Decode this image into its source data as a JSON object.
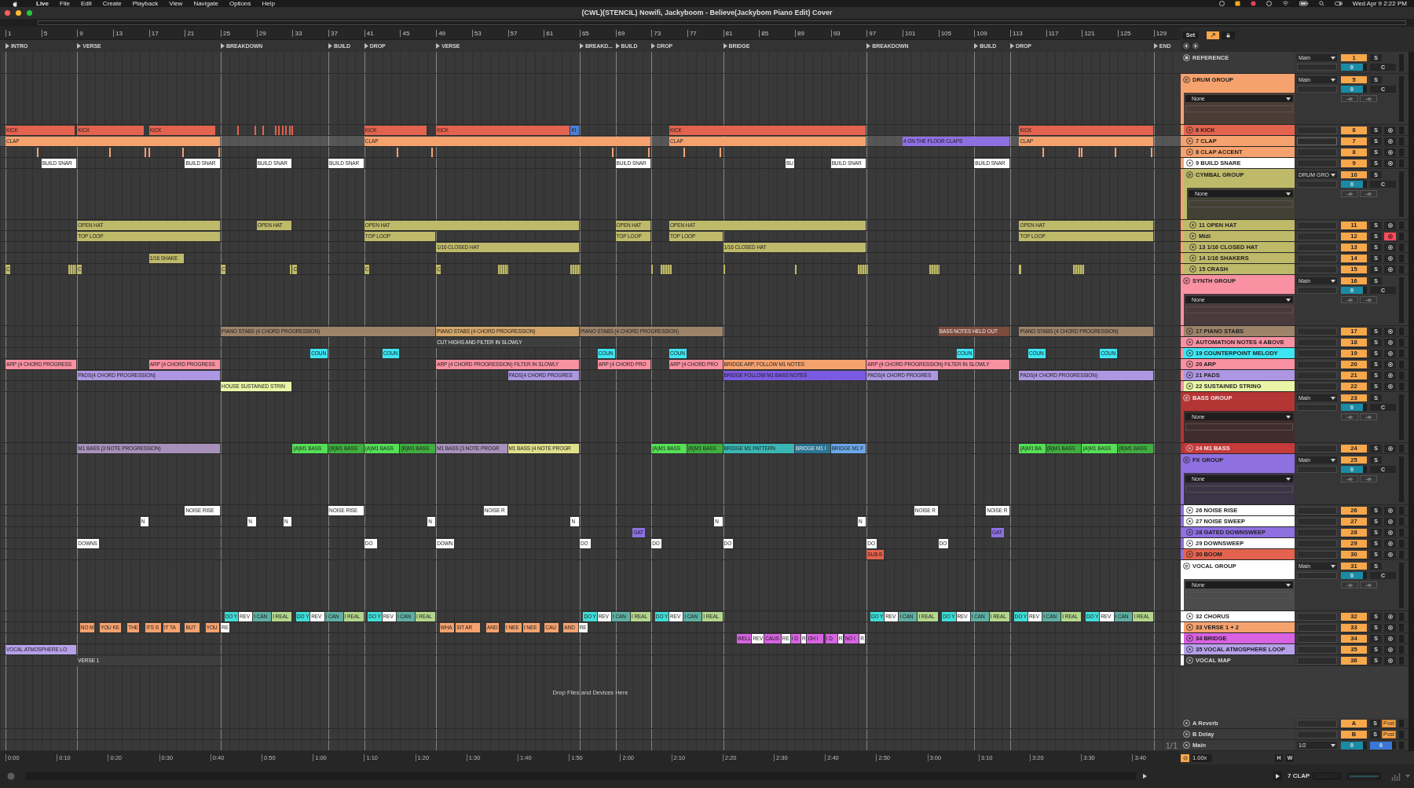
{
  "menu_bar": {
    "items": [
      "Live",
      "File",
      "Edit",
      "Create",
      "Playback",
      "View",
      "Navigate",
      "Options",
      "Help"
    ],
    "clock": "Wed Apr 9 2:22 PM"
  },
  "window": {
    "title": "(CWL)(STENCIL) Nowifi, Jackyboom - Believe(Jackybom Piano Edit) Cover"
  },
  "ruler": {
    "bars": [
      "1",
      "5",
      "9",
      "13",
      "17",
      "21",
      "25",
      "29",
      "33",
      "37",
      "41",
      "45",
      "49",
      "53",
      "57",
      "61",
      "65",
      "69",
      "73",
      "77",
      "81",
      "85",
      "89",
      "93",
      "97",
      "101",
      "105",
      "109",
      "113",
      "117",
      "121",
      "125",
      "129"
    ]
  },
  "locators": [
    "INTRO",
    "VERSE",
    "BREAKDOWN",
    "BUILD",
    "DROP",
    "VERSE",
    "BREAKD...",
    "BUILD",
    "DROP",
    "BRIDGE",
    "BREAKDOWN",
    "BUILD",
    "DROP"
  ],
  "end_marker": "END",
  "set_button": "Set",
  "tracks": [
    {
      "kind": "reference",
      "name": "REFERENCE",
      "selected": false,
      "routing": "Main",
      "number": "1",
      "solo": "S",
      "volume": "0",
      "cue": "C"
    },
    {
      "kind": "group",
      "name": "DRUM GROUP",
      "color": "#f6a26f",
      "selected": false,
      "device": "None",
      "routing": "Main",
      "number": "5",
      "solo": "S",
      "volume": "0",
      "cue": "C",
      "peaks": [
        "-∞",
        "-∞"
      ],
      "children": [
        {
          "kind": "track",
          "name": "6 KICK",
          "color": "#e3634f",
          "selected": false,
          "number": "6",
          "solo": "S",
          "armed": false,
          "clips": [
            {
              "kind": "clip",
              "name": "KICK"
            },
            {
              "kind": "clip",
              "name": "KICK"
            },
            {
              "kind": "clip",
              "name": "KICK"
            },
            {
              "kind": "hit"
            },
            {
              "kind": "hit"
            },
            {
              "kind": "hit"
            },
            {
              "kind": "hit"
            },
            {
              "kind": "hit"
            },
            {
              "kind": "hit"
            },
            {
              "kind": "hit"
            },
            {
              "kind": "hit"
            },
            {
              "kind": "hit"
            },
            {
              "kind": "clip",
              "name": "KICK"
            },
            {
              "kind": "clip",
              "name": "KICK"
            },
            {
              "kind": "clip",
              "name": "KI",
              "color": "#4b7fd6"
            },
            {
              "kind": "clip",
              "name": "KICK"
            },
            {
              "kind": "clip",
              "name": "KICK"
            }
          ]
        },
        {
          "kind": "track",
          "name": "7 CLAP",
          "color": "#f6a26f",
          "selected": true,
          "number": "7",
          "solo": "S",
          "armed": false,
          "clips": [
            {
              "name": "CLAP"
            },
            {
              "name": "CLAP"
            },
            {
              "name": "CLAP"
            },
            {
              "name": "4 ON THE FLOOR CLAPS",
              "color": "#8e70e1"
            },
            {
              "name": "CLAP"
            }
          ]
        },
        {
          "kind": "track",
          "name": "8 CLAP ACCENT",
          "color": "#f6a26f",
          "selected": false,
          "number": "8",
          "solo": "S",
          "armed": false,
          "clips": [
            {
              "kind": "hit"
            },
            {
              "kind": "hit"
            },
            {
              "kind": "hit"
            },
            {
              "kind": "hit"
            },
            {
              "kind": "hit"
            },
            {
              "kind": "hit"
            },
            {
              "kind": "hit"
            },
            {
              "kind": "hit"
            },
            {
              "kind": "hit"
            },
            {
              "kind": "hit"
            },
            {
              "kind": "hit"
            },
            {
              "kind": "hit"
            },
            {
              "kind": "hit"
            },
            {
              "kind": "hit"
            },
            {
              "kind": "hit"
            },
            {
              "kind": "hit"
            },
            {
              "kind": "hit"
            }
          ]
        },
        {
          "kind": "track",
          "name": "9 BUILD SNARE",
          "color": "#ffffff",
          "selected": false,
          "number": "9",
          "solo": "S",
          "armed": false,
          "clips": [
            {
              "name": "BUILD SNAR"
            },
            {
              "name": "BUILD SNAR"
            },
            {
              "name": "BUILD SNAR"
            },
            {
              "name": "BUILD SNAR"
            },
            {
              "name": "BUILD SNAR"
            },
            {
              "name": "BU"
            },
            {
              "name": "BUILD SNAR"
            },
            {
              "name": "BUILD SNAR"
            }
          ]
        },
        {
          "kind": "group",
          "name": "CYMBAL GROUP",
          "color": "#bfba6a",
          "selected": false,
          "device": "None",
          "routing": "DRUM GRO",
          "number": "10",
          "solo": "S",
          "volume": "0",
          "cue": "C",
          "peaks": [
            "-∞",
            "-∞"
          ],
          "children": [
            {
              "kind": "track",
              "name": "11 OPEN HAT",
              "color": "#bfba6a",
              "selected": false,
              "number": "11",
              "solo": "S",
              "armed": false,
              "clips": [
                {
                  "name": "OPEN HAT"
                },
                {
                  "name": "OPEN HAT"
                },
                {
                  "name": "OPEN HAT"
                },
                {
                  "name": "OPEN HAT"
                },
                {
                  "name": "OPEN HAT"
                },
                {
                  "name": "OPEN HAT"
                }
              ]
            },
            {
              "kind": "track",
              "name": "Midi",
              "color": "#bfba6a",
              "selected": false,
              "number": "12",
              "solo": "S",
              "armed": true,
              "clips": [
                {
                  "name": "TOP LOOP"
                },
                {
                  "name": "TOP LOOP"
                },
                {
                  "name": "TOP LOOP"
                },
                {
                  "name": "TOP LOOP"
                },
                {
                  "name": "TOP LOOP"
                }
              ]
            },
            {
              "kind": "track",
              "name": "13 1/16 CLOSED HAT",
              "color": "#bfba6a",
              "selected": false,
              "number": "13",
              "solo": "S",
              "armed": false,
              "clips": [
                {
                  "name": "1/16 CLOSED HAT"
                },
                {
                  "name": "1/16 CLOSED HAT"
                }
              ]
            },
            {
              "kind": "track",
              "name": "14 1/16 SHAKERS",
              "color": "#bfba6a",
              "selected": false,
              "number": "14",
              "solo": "S",
              "armed": false,
              "clips": [
                {
                  "name": "1/16 SHAKE"
                }
              ]
            },
            {
              "kind": "track",
              "name": "15 CRASH",
              "color": "#bfba6a",
              "selected": false,
              "number": "15",
              "solo": "S",
              "armed": false,
              "clips": [
                {
                  "kind": "clip",
                  "name": "C"
                },
                {
                  "kind": "hit"
                },
                {
                  "kind": "clip",
                  "name": "C"
                },
                {
                  "kind": "clip",
                  "name": "C"
                },
                {
                  "kind": "hit"
                },
                {
                  "kind": "clip",
                  "name": "C"
                },
                {
                  "kind": "clip",
                  "name": "C"
                },
                {
                  "kind": "clip",
                  "name": "C"
                },
                {
                  "kind": "hit"
                },
                {
                  "kind": "hit"
                },
                {
                  "kind": "hit"
                },
                {
                  "kind": "hit"
                },
                {
                  "kind": "hit"
                },
                {
                  "kind": "hit"
                },
                {
                  "kind": "hit"
                },
                {
                  "kind": "hit"
                },
                {
                  "kind": "hit"
                },
                {
                  "kind": "hit"
                }
              ]
            }
          ]
        }
      ]
    },
    {
      "kind": "group",
      "name": "SYNTH GROUP",
      "color": "#f991a2",
      "selected": false,
      "device": "None",
      "routing": "Main",
      "number": "16",
      "solo": "S",
      "volume": "0",
      "cue": "C",
      "peaks": [
        "-∞",
        "-∞"
      ],
      "children": [
        {
          "kind": "track",
          "name": "17 PIANO STABS",
          "color": "#9c8369",
          "selected": false,
          "number": "17",
          "solo": "S",
          "armed": false,
          "clips": [
            {
              "name": "PIANO STABS (4 CHORD PROGRESSION)"
            },
            {
              "name": "PIANO STABS (4 CHORD PROGRESSION)",
              "color": "#d4a66b"
            },
            {
              "name": "PIANO STABS (4 CHORD PROGRESSION)"
            },
            {
              "name": "BASS NOTES HELD OUT",
              "color": "#7d4c3d"
            },
            {
              "name": "PIANO STABS (4 CHORD PROGRESSION)"
            }
          ]
        },
        {
          "kind": "track",
          "name": "AUTOMATION NOTES 4 ABOVE",
          "color": "#f991a2",
          "selected": false,
          "number": "18",
          "solo": "S",
          "armed": false,
          "clips": [
            {
              "name": "CUT HIGHS AND FILTER IN SLOWLY",
              "color": "#3e3e3e"
            }
          ]
        },
        {
          "kind": "track",
          "name": "19 COUNTERPOINT MELODY",
          "color": "#3ee5f3",
          "selected": false,
          "number": "19",
          "solo": "S",
          "armed": false,
          "clips": [
            {
              "name": "COUN"
            },
            {
              "name": "COUN"
            },
            {
              "name": "COUN"
            },
            {
              "name": "COUN"
            },
            {
              "name": "COUN"
            },
            {
              "name": "COUN"
            },
            {
              "name": "COUN"
            }
          ]
        },
        {
          "kind": "track",
          "name": "20 ARP",
          "color": "#f991a2",
          "selected": false,
          "number": "20",
          "solo": "S",
          "armed": false,
          "clips": [
            {
              "name": "ARP (4 CHORD PROGRESS"
            },
            {
              "name": "ARP (4 CHORD PROGRESS"
            },
            {
              "name": "ARP (4 CHORD PROGRESSION) FILTER IN SLOWLY"
            },
            {
              "name": "ARP (4 CHORD PRO"
            },
            {
              "name": "ARP (4 CHORD PRO"
            },
            {
              "name": "BRIDGE ARP, FOLLOW M1 NOTES",
              "color": "#f6a26f"
            },
            {
              "name": "ARP (4 CHORD PROGRESSION) FILTER IN SLOWLY"
            }
          ]
        },
        {
          "kind": "track",
          "name": "21 PADS",
          "color": "#ad97e2",
          "selected": false,
          "number": "21",
          "solo": "S",
          "armed": false,
          "clips": [
            {
              "name": "PADS(4 CHORD PROGRESSION)"
            },
            {
              "name": "PADS(4 CHORD PROGRES"
            },
            {
              "name": "BRIDGE FOLLOW M1 BASS NOTES",
              "color": "#7b5be1"
            },
            {
              "name": "PADS(4 CHORD PROGRES"
            },
            {
              "name": "PADS(4 CHORD PROGRESSION)"
            }
          ]
        },
        {
          "kind": "track",
          "name": "22 SUSTAINED STRING",
          "color": "#eaf6a6",
          "selected": false,
          "number": "22",
          "solo": "S",
          "armed": false,
          "clips": [
            {
              "name": "HOUSE SUSTAINED STRIN"
            }
          ]
        }
      ]
    },
    {
      "kind": "group",
      "name": "BASS GROUP",
      "color": "#b53434",
      "selected": false,
      "device": "None",
      "routing": "Main",
      "number": "23",
      "solo": "S",
      "volume": "0",
      "cue": "C",
      "peaks": [
        "-∞",
        "-∞"
      ],
      "children": [
        {
          "kind": "track",
          "name": "24 M1 BASS",
          "color": "#c63a3a",
          "selected": false,
          "number": "24",
          "solo": "S",
          "armed": false,
          "clips": [
            {
              "name": "M1 BASS (3 NOTE PROGRESSION)",
              "color": "#a791ba"
            },
            {
              "name": "(A)M1 BASS",
              "color": "#55e055"
            },
            {
              "name": "(B)M1 BASS",
              "color": "#3fae3f"
            },
            {
              "name": "(A)M1 BASS",
              "color": "#55e055"
            },
            {
              "name": "(B)M1 BASS",
              "color": "#3fae3f"
            },
            {
              "name": "M1 BASS (3 NOTE PROGR",
              "color": "#a791ba"
            },
            {
              "name": "M1 BASS (4 NOTE PROGR",
              "color": "#e0e08c"
            },
            {
              "name": "(A)M1 BASS",
              "color": "#55e055"
            },
            {
              "name": "(B)M1 BASS",
              "color": "#3fae3f"
            },
            {
              "name": "BRIDGE M1 PATTERN",
              "color": "#3ab7b4"
            },
            {
              "name": "BRIDGE M1 I",
              "color": "#2b7594"
            },
            {
              "name": "BRIDGE M1 F",
              "color": "#6ba7e8"
            },
            {
              "name": "(A)M1 BA",
              "color": "#55e055"
            },
            {
              "name": "(B)M1 BASS",
              "color": "#3fae3f"
            },
            {
              "name": "(A)M1 BASS",
              "color": "#55e055"
            },
            {
              "name": "(B)M1 BASS",
              "color": "#3fae3f"
            }
          ]
        }
      ]
    },
    {
      "kind": "group",
      "name": "FX GROUP",
      "color": "#8e70e1",
      "selected": false,
      "device": "None",
      "routing": "Main",
      "number": "25",
      "solo": "S",
      "volume": "0",
      "cue": "C",
      "peaks": [
        "-∞",
        "-∞"
      ],
      "children": [
        {
          "kind": "track",
          "name": "26 NOISE RISE",
          "color": "#ffffff",
          "selected": false,
          "number": "26",
          "solo": "S",
          "armed": false,
          "clips": [
            {
              "name": "NOISE RISE"
            },
            {
              "name": "NOISE RISE"
            },
            {
              "name": "NOISE R"
            },
            {
              "name": "NOISE R"
            },
            {
              "name": "NOISE R"
            }
          ]
        },
        {
          "kind": "track",
          "name": "27 NOISE SWEEP",
          "color": "#ffffff",
          "selected": false,
          "number": "27",
          "solo": "S",
          "armed": false,
          "clips": [
            {
              "name": "N"
            },
            {
              "name": "N"
            },
            {
              "name": "N"
            },
            {
              "name": "N"
            },
            {
              "name": "N"
            },
            {
              "name": "N"
            },
            {
              "name": "N"
            }
          ]
        },
        {
          "kind": "track",
          "name": "28 GATED DOWNSWEEP",
          "color": "#8e70e1",
          "selected": false,
          "number": "28",
          "solo": "S",
          "armed": false,
          "clips": [
            {
              "name": "GAT"
            },
            {
              "name": "GAT"
            }
          ]
        },
        {
          "kind": "track",
          "name": "29 DOWNSWEEP",
          "color": "#ffffff",
          "selected": false,
          "number": "29",
          "solo": "S",
          "armed": false,
          "clips": [
            {
              "name": "DOWNS"
            },
            {
              "name": "DO"
            },
            {
              "name": "DOWN"
            },
            {
              "name": "DO"
            },
            {
              "name": "DO"
            },
            {
              "name": "DO"
            },
            {
              "name": "DO"
            },
            {
              "name": "DO"
            }
          ]
        },
        {
          "kind": "track",
          "name": "30 BOOM",
          "color": "#e3634f",
          "selected": false,
          "number": "30",
          "solo": "S",
          "armed": false,
          "clips": [
            {
              "name": "SUB B"
            }
          ]
        }
      ]
    },
    {
      "kind": "group",
      "name": "VOCAL GROUP",
      "color": "#ffffff",
      "selected": false,
      "device": "None",
      "routing": "Main",
      "number": "31",
      "solo": "S",
      "volume": "0",
      "cue": "C",
      "peaks": [
        "-∞",
        "-∞"
      ],
      "children": [
        {
          "kind": "track",
          "name": "32 CHORUS",
          "color": "#ffffff",
          "selected": false,
          "number": "32",
          "solo": "S",
          "armed": false,
          "clips": [
            {
              "name": "DO Y",
              "color": "#40dcd6"
            },
            {
              "name": "REV"
            },
            {
              "name": "I CAN",
              "color": "#5eaea3"
            },
            {
              "name": "I REAL",
              "color": "#b4d68c"
            },
            {
              "name": "DO Y",
              "color": "#40dcd6"
            },
            {
              "name": "REV"
            },
            {
              "name": "I CAN",
              "color": "#5eaea3"
            },
            {
              "name": "I REAL",
              "color": "#b4d68c"
            },
            {
              "name": "DO Y",
              "color": "#40dcd6"
            },
            {
              "name": "REV"
            },
            {
              "name": "I CAN",
              "color": "#5eaea3"
            },
            {
              "name": "I REAL",
              "color": "#b4d68c"
            },
            {
              "name": "DO Y",
              "color": "#40dcd6"
            },
            {
              "name": "REV"
            },
            {
              "name": "I CAN",
              "color": "#5eaea3"
            },
            {
              "name": "I REAL",
              "color": "#b4d68c"
            },
            {
              "name": "DO Y",
              "color": "#40dcd6"
            },
            {
              "name": "REV"
            },
            {
              "name": "I CAN",
              "color": "#5eaea3"
            },
            {
              "name": "I REAL",
              "color": "#b4d68c"
            },
            {
              "name": "DO Y",
              "color": "#40dcd6"
            },
            {
              "name": "REV"
            },
            {
              "name": "I CAN",
              "color": "#5eaea3"
            },
            {
              "name": "I REAL",
              "color": "#b4d68c"
            },
            {
              "name": "DO Y",
              "color": "#40dcd6"
            },
            {
              "name": "REV"
            },
            {
              "name": "I CAN",
              "color": "#5eaea3"
            },
            {
              "name": "I REAL",
              "color": "#b4d68c"
            },
            {
              "name": "DO Y",
              "color": "#40dcd6"
            },
            {
              "name": "REV"
            },
            {
              "name": "I CAN",
              "color": "#5eaea3"
            },
            {
              "name": "I REAL",
              "color": "#b4d68c"
            },
            {
              "name": "DO Y",
              "color": "#40dcd6"
            },
            {
              "name": "REV"
            },
            {
              "name": "I CAN",
              "color": "#5eaea3"
            },
            {
              "name": "I REAL",
              "color": "#b4d68c"
            }
          ]
        },
        {
          "kind": "track",
          "name": "33 VERSE 1 + 2",
          "color": "#f6a26f",
          "selected": false,
          "number": "33",
          "solo": "S",
          "armed": false,
          "clips": [
            {
              "name": "NO M"
            },
            {
              "name": "YOU KE"
            },
            {
              "name": "THE"
            },
            {
              "name": "ITS S"
            },
            {
              "name": "IT TA"
            },
            {
              "name": "BUT"
            },
            {
              "name": "YOU"
            },
            {
              "name": "RE",
              "color": "#ffffff"
            },
            {
              "name": "WHA"
            },
            {
              "name": "SIT AR"
            },
            {
              "name": "AND"
            },
            {
              "name": "I NEE"
            },
            {
              "name": "I NEE"
            },
            {
              "name": "CAU"
            },
            {
              "name": "AND"
            },
            {
              "name": "RE",
              "color": "#ffffff"
            }
          ]
        },
        {
          "kind": "track",
          "name": "34 BRIDGE",
          "color": "#d862e2",
          "selected": false,
          "number": "34",
          "solo": "S",
          "armed": false,
          "clips": [
            {
              "name": "WELL"
            },
            {
              "name": "REV",
              "color": "#ffffff"
            },
            {
              "name": "CAUS"
            },
            {
              "name": "RE",
              "color": "#ffffff"
            },
            {
              "name": "I D"
            },
            {
              "name": "R",
              "color": "#ffffff"
            },
            {
              "name": "OH I"
            },
            {
              "name": "I D"
            },
            {
              "name": "R",
              "color": "#ffffff"
            },
            {
              "name": "NO I"
            },
            {
              "name": "R",
              "color": "#ffffff"
            }
          ]
        },
        {
          "kind": "track",
          "name": "35 VOCAL ATMOSPHERE LOOP",
          "color": "#b6a0e8",
          "selected": false,
          "number": "35",
          "solo": "S",
          "armed": false,
          "clips": [
            {
              "name": "VOCAL ATMOSPHERE LO"
            }
          ]
        },
        {
          "kind": "track",
          "name": "VOCAL MAP",
          "selected": false,
          "number": "36",
          "solo": "S",
          "armed": false,
          "clips": [
            {
              "name": "VERSE 1",
              "color": "#3e3e3e"
            }
          ]
        }
      ]
    }
  ],
  "arrangement": {
    "drop_hint": "Drop Files and Devices Here",
    "grid": "1/1",
    "time_ruler": [
      "0:00",
      "0:10",
      "0:20",
      "0:30",
      "0:40",
      "0:50",
      "1:00",
      "1:10",
      "1:20",
      "1:30",
      "1:40",
      "1:50",
      "2:00",
      "2:10",
      "2:20",
      "2:30",
      "2:40",
      "2:50",
      "3:00",
      "3:10",
      "3:20",
      "3:30",
      "3:40"
    ]
  },
  "returns": [
    {
      "kind": "return",
      "name": "A Reverb",
      "selected": false,
      "number": "A",
      "solo": "S",
      "post": "Post"
    },
    {
      "kind": "return",
      "name": "B Delay",
      "selected": false,
      "number": "B",
      "solo": "S",
      "post": "Post"
    },
    {
      "kind": "main",
      "name": "Main",
      "selected": false,
      "routing": "1/2",
      "volume": "0",
      "cue_volume": "0"
    }
  ],
  "mixer_footer": {
    "zoom": "1.00x",
    "buttons": [
      "H",
      "W"
    ]
  },
  "status_bar": {
    "track": "7 CLAP"
  }
}
